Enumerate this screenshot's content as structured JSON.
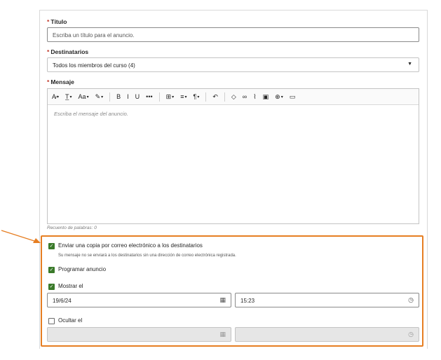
{
  "form": {
    "required_mark": "*",
    "title_label": "Título",
    "title_placeholder": "Escriba un título para el anuncio.",
    "recipients_label": "Destinatarios",
    "recipients_value": "Todos los miembros del curso (4)",
    "message_label": "Mensaje",
    "message_placeholder": "Escriba el mensaje del anuncio.",
    "word_count": "Recuento de palabras: 0"
  },
  "toolbar": [
    {
      "icon": "text-style-icon",
      "glyph": "A̷",
      "caret": true
    },
    {
      "icon": "paragraph-format-icon",
      "glyph": "T̲",
      "caret": true
    },
    {
      "icon": "font-size-icon",
      "glyph": "Aa",
      "caret": true
    },
    {
      "icon": "text-color-icon",
      "glyph": "✎",
      "caret": true
    },
    {
      "icon": "bold-icon",
      "glyph": "B",
      "caret": false
    },
    {
      "icon": "italic-icon",
      "glyph": "I",
      "caret": false
    },
    {
      "icon": "underline-icon",
      "glyph": "U",
      "caret": false
    },
    {
      "icon": "more-icon",
      "glyph": "•••",
      "caret": false
    },
    {
      "icon": "table-icon",
      "glyph": "⊞",
      "caret": true
    },
    {
      "icon": "align-icon",
      "glyph": "≡",
      "caret": true
    },
    {
      "icon": "paragraph-icon",
      "glyph": "¶",
      "caret": true
    },
    {
      "icon": "undo-icon",
      "glyph": "↶",
      "caret": false
    },
    {
      "icon": "eraser-icon",
      "glyph": "◇",
      "caret": false
    },
    {
      "icon": "link-icon",
      "glyph": "∞",
      "caret": false
    },
    {
      "icon": "attachment-icon",
      "glyph": "⌇",
      "caret": false
    },
    {
      "icon": "image-icon",
      "glyph": "▣",
      "caret": false
    },
    {
      "icon": "insert-icon",
      "glyph": "⊕",
      "caret": true
    },
    {
      "icon": "media-icon",
      "glyph": "▭",
      "caret": false
    }
  ],
  "options": {
    "email_copy": {
      "label": "Enviar una copia por correo electrónico a los destinatarios",
      "checked": true
    },
    "email_note": "Su mensaje no se enviará a los destinatarios sin una dirección de correo electrónica registrada.",
    "schedule": {
      "label": "Programar anuncio",
      "checked": true
    },
    "show": {
      "label": "Mostrar el",
      "checked": true,
      "date": "19/6/24",
      "time": "15:23"
    },
    "hide": {
      "label": "Ocultar el",
      "checked": false,
      "date": "",
      "time": ""
    }
  },
  "colors": {
    "highlight_border": "#e67e22",
    "checkbox_checked": "#3a7a2a",
    "required": "#c0392b"
  }
}
